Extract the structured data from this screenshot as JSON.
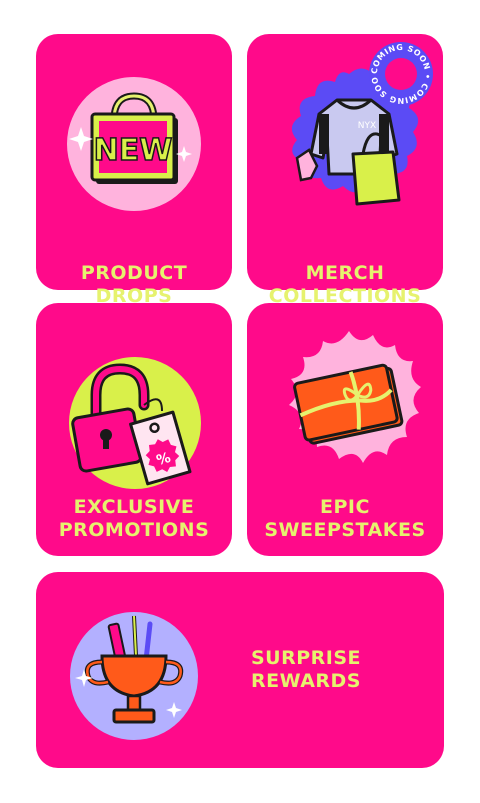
{
  "colors": {
    "card_bg": "#ff0a8a",
    "label_text": "#e6f26e",
    "accent_lime": "#d9f04a",
    "accent_blue": "#5b4bf5",
    "accent_orange": "#ff5a1a",
    "accent_pink_light": "#ffb3dd",
    "accent_lavender": "#b3b0ff"
  },
  "cards": [
    {
      "id": "product-drops",
      "line1": "PRODUCT",
      "line2": "DROPS",
      "icon": "shopping-bag-new-icon",
      "icon_text": "NEW"
    },
    {
      "id": "merch-collections",
      "line1": "MERCH",
      "line2": "COLLECTIONS",
      "icon": "merch-hoodie-tote-icon",
      "icon_text": "NYX",
      "badge": "COMING SOON",
      "badge_text": "COMING SOON • COMING SOON •"
    },
    {
      "id": "exclusive-promotions",
      "line1": "EXCLUSIVE",
      "line2": "PROMOTIONS",
      "icon": "lock-and-discount-tag-icon",
      "icon_text": "%"
    },
    {
      "id": "epic-sweepstakes",
      "line1": "EPIC",
      "line2": "SWEEPSTAKES",
      "icon": "gift-box-icon"
    },
    {
      "id": "surprise-rewards",
      "line1": "SURPRISE",
      "line2": "REWARDS",
      "icon": "trophy-makeup-icon"
    }
  ]
}
